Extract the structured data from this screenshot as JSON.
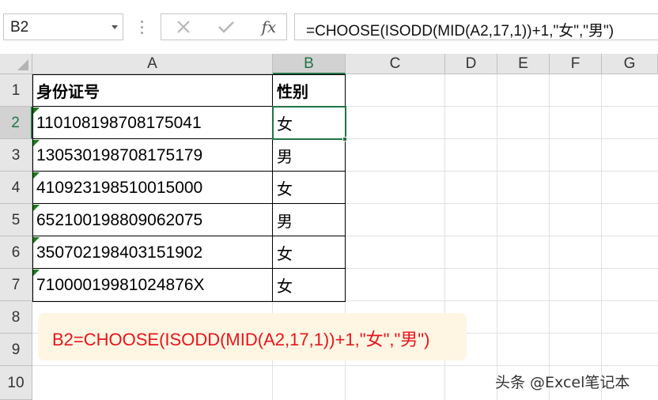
{
  "name_box": {
    "value": "B2"
  },
  "formula_bar": {
    "cancel_icon": "cancel-x-icon",
    "enter_icon": "checkmark-icon",
    "fx_label": "fx",
    "formula": "=CHOOSE(ISODD(MID(A2,17,1))+1,\"女\",\"男\")"
  },
  "columns": [
    "A",
    "B",
    "C",
    "D",
    "E",
    "F",
    "G"
  ],
  "rows": [
    "1",
    "2",
    "3",
    "4",
    "5",
    "6",
    "7",
    "8",
    "9",
    "10"
  ],
  "selected_cell": "B2",
  "table": {
    "headers": [
      "身份证号",
      "性别"
    ],
    "rows": [
      {
        "id": "110108198708175041",
        "gender": "女"
      },
      {
        "id": "130530198708175179",
        "gender": "男"
      },
      {
        "id": "410923198510015000",
        "gender": "女"
      },
      {
        "id": "652100198809062075",
        "gender": "男"
      },
      {
        "id": "350702198403151902",
        "gender": "女"
      },
      {
        "id": "710000199810248 76X",
        "gender": "女"
      }
    ]
  },
  "callout": {
    "text": "B2=CHOOSE(ISODD(MID(A2,17,1))+1,\"女\",\"男\")"
  },
  "watermark": {
    "text": "头条 @Excel笔记本"
  },
  "colors": {
    "accent": "#217346",
    "callout_bg": "#fef6e3",
    "callout_text": "#e8141b"
  }
}
